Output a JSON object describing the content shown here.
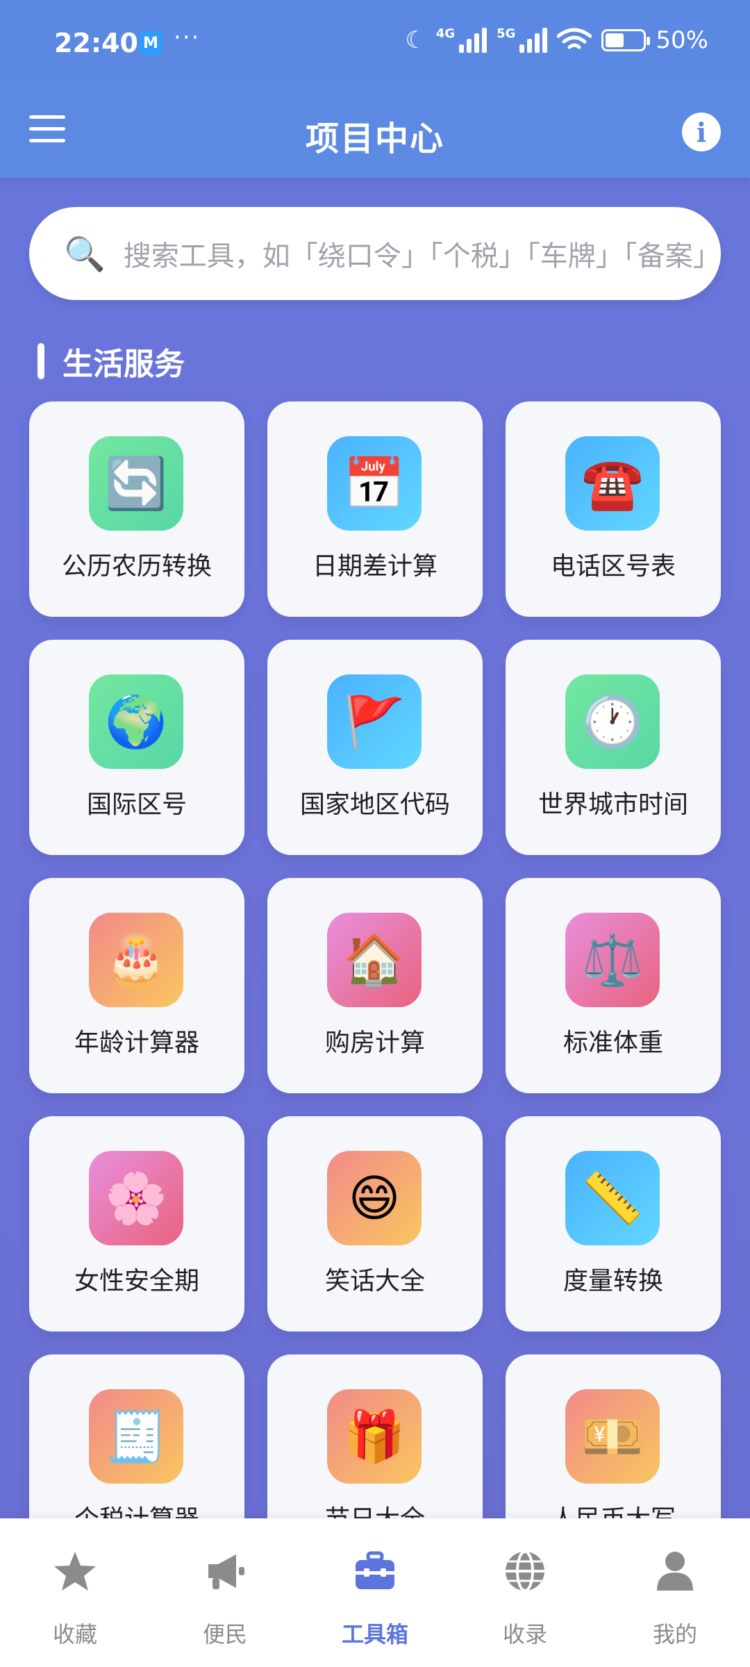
{
  "status_bar": {
    "time": "22:40",
    "app_badge": "M",
    "dots": "···",
    "net_4g": "4G",
    "net_5g": "5G",
    "battery_pct": "50%",
    "battery_level": 0.5
  },
  "header": {
    "title": "项目中心",
    "info_glyph": "i"
  },
  "search": {
    "placeholder": "搜索工具，如「绕口令」「个税」「车牌」「备案」",
    "icon": "magnifier-icon"
  },
  "section": {
    "title": "生活服务"
  },
  "tools": [
    {
      "label": "公历农历转换",
      "emoji": "🔄",
      "icon": "convert-arrows-icon",
      "bg": "green"
    },
    {
      "label": "日期差计算",
      "emoji": "📅",
      "icon": "calendar-icon",
      "bg": "blue"
    },
    {
      "label": "电话区号表",
      "emoji": "☎️",
      "icon": "telephone-icon",
      "bg": "blue"
    },
    {
      "label": "国际区号",
      "emoji": "🌍",
      "icon": "globe-icon",
      "bg": "green"
    },
    {
      "label": "国家地区代码",
      "emoji": "🚩",
      "icon": "flag-icon",
      "bg": "blue"
    },
    {
      "label": "世界城市时间",
      "emoji": "🕐",
      "icon": "clock-icon",
      "bg": "green"
    },
    {
      "label": "年龄计算器",
      "emoji": "🎂",
      "icon": "birthday-cake-icon",
      "bg": "orange"
    },
    {
      "label": "购房计算",
      "emoji": "🏠",
      "icon": "house-icon",
      "bg": "pink"
    },
    {
      "label": "标准体重",
      "emoji": "⚖️",
      "icon": "scale-icon",
      "bg": "pink"
    },
    {
      "label": "女性安全期",
      "emoji": "🌸",
      "icon": "blossom-icon",
      "bg": "pink"
    },
    {
      "label": "笑话大全",
      "emoji": "😄",
      "icon": "smile-icon",
      "bg": "orange"
    },
    {
      "label": "度量转换",
      "emoji": "📏",
      "icon": "ruler-icon",
      "bg": "blue"
    },
    {
      "label": "个税计算器",
      "emoji": "🧾",
      "icon": "receipt-icon",
      "bg": "orange"
    },
    {
      "label": "节日大全",
      "emoji": "🎁",
      "icon": "gift-icon",
      "bg": "orange"
    },
    {
      "label": "人民币大写",
      "emoji": "💴",
      "icon": "yen-banknote-icon",
      "bg": "orange"
    }
  ],
  "tabs": [
    {
      "label": "收藏",
      "icon": "star-icon",
      "active": false
    },
    {
      "label": "便民",
      "icon": "megaphone-icon",
      "active": false
    },
    {
      "label": "工具箱",
      "icon": "toolbox-icon",
      "active": true
    },
    {
      "label": "收录",
      "icon": "globe-icon",
      "active": false
    },
    {
      "label": "我的",
      "icon": "person-icon",
      "active": false
    }
  ],
  "colors": {
    "header": "#5a88e2",
    "background": "#6a72d8",
    "accent": "#5b74de",
    "tab_inactive": "#8b8b8b"
  }
}
